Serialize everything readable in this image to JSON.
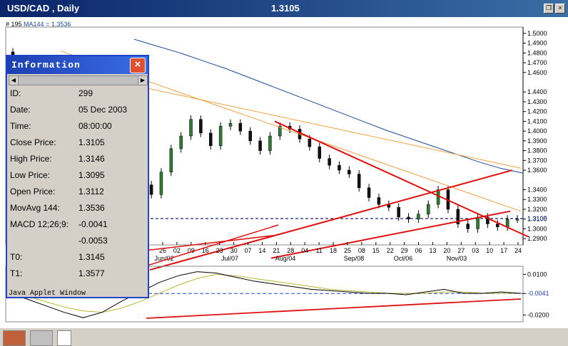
{
  "window": {
    "title": "USD/CAD , Daily",
    "price": "1.3105"
  },
  "indicator_label": {
    "count": "# 195",
    "ma": "MA144 = 1.3536"
  },
  "info": {
    "title": "Information",
    "footer": "Java Applet Window",
    "rows": [
      {
        "label": "ID:",
        "value": "299"
      },
      {
        "label": "Date:",
        "value": "05 Dec 2003"
      },
      {
        "label": "Time:",
        "value": "08:00:00"
      },
      {
        "label": "Close Price:",
        "value": "1.3105"
      },
      {
        "label": "High Price:",
        "value": "1.3146"
      },
      {
        "label": "Low Price:",
        "value": "1.3095"
      },
      {
        "label": "Open Price:",
        "value": "1.3112"
      },
      {
        "label": "MovAvg 144:",
        "value": "1.3536"
      },
      {
        "label": "MACD 12;26;9:",
        "value": "-0.0041"
      },
      {
        "label": "",
        "value": "-0.0053"
      },
      {
        "label": "T0:",
        "value": "1.3145"
      },
      {
        "label": "T1:",
        "value": "1.3577"
      }
    ]
  },
  "chart_data": {
    "type": "line",
    "title": "USD/CAD , Daily",
    "price_axis": {
      "ticks": [
        "1.5000",
        "1.4900",
        "1.4800",
        "1.4700",
        "1.4600",
        "1.4400",
        "1.4300",
        "1.4200",
        "1.4100",
        "1.4000",
        "1.3900",
        "1.3800",
        "1.3700",
        "1.3600",
        "1.3400",
        "1.3300",
        "1.3200",
        "1.3100",
        "1.3000",
        "1.2900"
      ],
      "current": "1.3105",
      "ylim": [
        1.285,
        1.505
      ]
    },
    "x_ticks": [
      "26",
      "02",
      "09",
      "16",
      "23",
      "30",
      "07",
      "14",
      "21",
      "28",
      "04",
      "11",
      "18",
      "25",
      "08",
      "15",
      "22",
      "29",
      "06",
      "13",
      "20",
      "27",
      "03",
      "10",
      "17",
      "24"
    ],
    "month_labels": [
      "Jun/02",
      "Jul/07",
      "Aug/04",
      "Sep/08",
      "Oct/06",
      "Nov/03"
    ],
    "series": [
      {
        "name": "MA144 = 1.3536",
        "color": "#1a4a9a",
        "values": [
          1.494,
          1.487,
          1.48,
          1.472,
          1.464,
          1.455,
          1.446,
          1.437,
          1.428,
          1.419,
          1.41,
          1.401,
          1.393,
          1.385,
          1.377,
          1.369,
          1.362,
          1.357
        ]
      }
    ],
    "price_path": [
      1.481,
      1.448,
      1.43,
      1.406,
      1.39,
      1.382,
      1.37,
      1.36,
      1.35,
      1.338,
      1.333,
      1.35,
      1.36,
      1.352,
      1.345,
      1.335,
      1.358,
      1.382,
      1.395,
      1.412,
      1.398,
      1.385,
      1.405,
      1.408,
      1.4,
      1.39,
      1.38,
      1.395,
      1.405,
      1.402,
      1.392,
      1.384,
      1.372,
      1.365,
      1.36,
      1.356,
      1.342,
      1.332,
      1.325,
      1.322,
      1.312,
      1.31,
      1.315,
      1.325,
      1.34,
      1.32,
      1.305,
      1.3,
      1.312,
      1.305,
      1.302,
      1.31
    ],
    "macd_axis": {
      "ticks": [
        "0.0100",
        "-0.0041",
        "-0.0200"
      ],
      "ylim": [
        -0.025,
        0.016
      ]
    },
    "macd_line": [
      -0.004,
      -0.008,
      -0.013,
      -0.018,
      -0.022,
      -0.018,
      -0.01,
      -0.003,
      0.004,
      0.009,
      0.012,
      0.011,
      0.008,
      0.005,
      0.003,
      0.001,
      -0.001,
      -0.002,
      -0.003,
      -0.004,
      -0.004,
      -0.005,
      -0.003,
      -0.001,
      -0.004,
      -0.004,
      -0.003,
      -0.004
    ],
    "signal_line": [
      -0.003,
      -0.006,
      -0.01,
      -0.014,
      -0.017,
      -0.018,
      -0.015,
      -0.01,
      -0.004,
      0.002,
      0.007,
      0.01,
      0.009,
      0.007,
      0.005,
      0.003,
      0.001,
      -0.001,
      -0.002,
      -0.003,
      -0.004,
      -0.004,
      -0.004,
      -0.003,
      -0.003,
      -0.004,
      -0.004,
      -0.004
    ]
  }
}
